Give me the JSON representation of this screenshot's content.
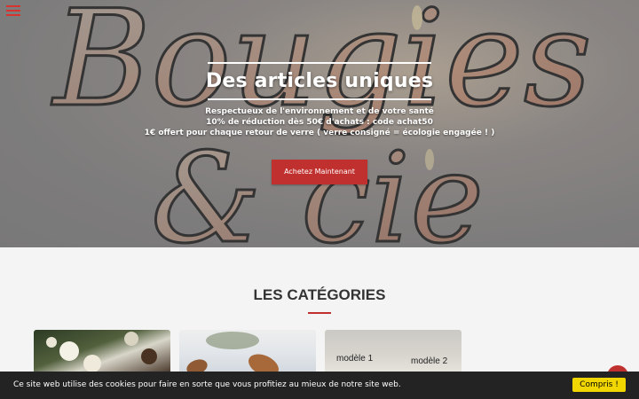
{
  "hero": {
    "title": "Des articles uniques",
    "lines": [
      "Respectueux de l'environnement et de votre santé",
      "10% de réduction dès 50€ d'achats : code achat50",
      "1€ offert pour chaque retour de verre ( verre consigné = écologie engagée ! )"
    ],
    "cta_label": "Achetez Maintenant",
    "logo_text_line1": "Bougies",
    "logo_text_line2": "& cie"
  },
  "categories": {
    "title": "LES CATÉGORIES",
    "cards": [
      {
        "name": "flowers"
      },
      {
        "name": "almonds"
      },
      {
        "labels": [
          "modèle 1",
          "modèle 2"
        ]
      }
    ]
  },
  "cookie": {
    "text": "Ce site web utilise des cookies pour faire en sorte que vous profitiez au mieux de notre site web.",
    "button_label": "Compris !"
  },
  "icons": {
    "menu": "hamburger-menu-icon",
    "chat": "chat-bubble-icon"
  },
  "colors": {
    "accent": "#c0302e",
    "cookie_bar": "#232323",
    "cookie_button": "#f1d600"
  }
}
